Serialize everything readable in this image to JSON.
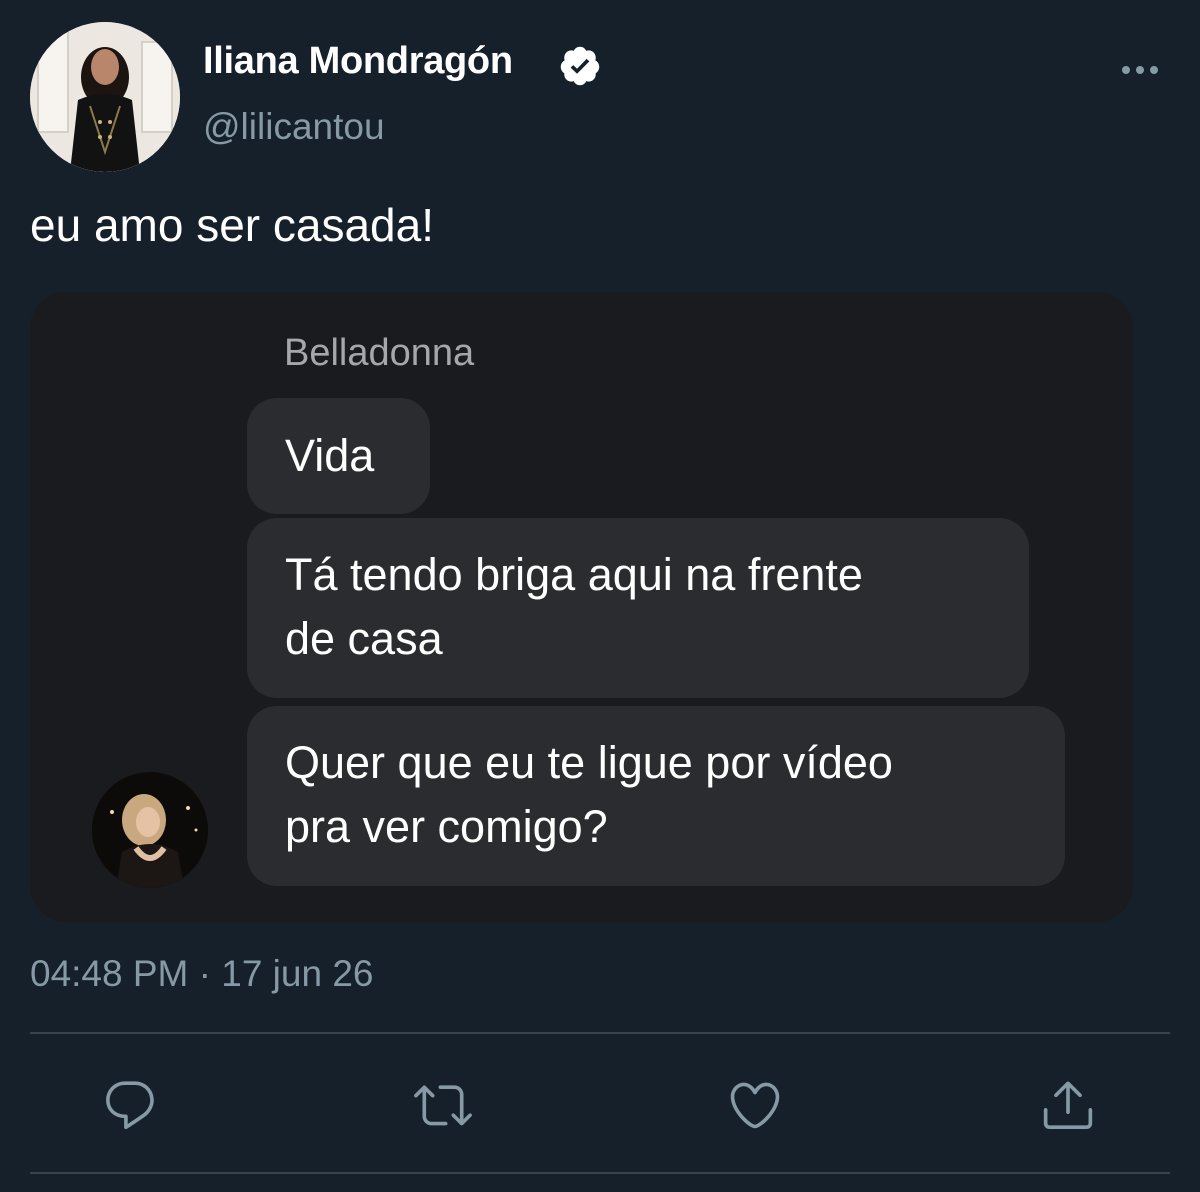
{
  "author": {
    "name": "Iliana Mondragón",
    "handle": "@lilicantou",
    "verified": true
  },
  "tweet": {
    "text": "eu amo ser casada!"
  },
  "media": {
    "sender_name": "Belladonna",
    "messages": [
      {
        "lines": [
          "Vida"
        ]
      },
      {
        "lines": [
          "Tá tendo briga aqui na frente",
          "de casa"
        ]
      },
      {
        "lines": [
          "Quer que eu te ligue por vídeo",
          "pra ver comigo?"
        ]
      }
    ]
  },
  "meta": {
    "timestamp": "04:48 PM · 17 jun 26"
  },
  "icons": {
    "more": "more-horizontal-icon",
    "reply": "reply-icon",
    "retweet": "retweet-icon",
    "like": "heart-icon",
    "share": "share-icon",
    "verified": "verified-badge-icon"
  },
  "colors": {
    "background": "#15202b",
    "secondary_text": "#8899a6",
    "media_background": "#1a1b1f",
    "bubble": "#2b2c30",
    "verified_badge": "#ffffff"
  }
}
